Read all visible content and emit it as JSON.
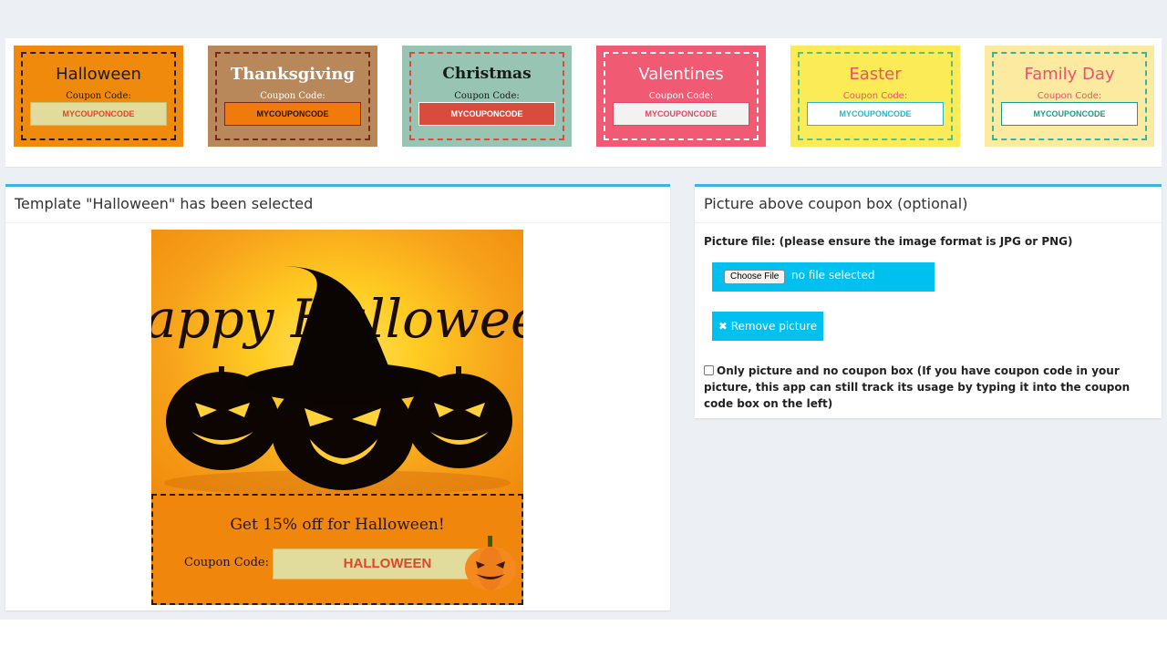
{
  "templates": [
    {
      "title": "Halloween",
      "coupon_label": "Coupon Code:",
      "code": "MYCOUPONCODE",
      "bg": "#f08a0c",
      "border": "#2b1b0b",
      "title_color": "#1a1a1a",
      "label_color": "#1a1a1a",
      "code_bg": "#e2dc9c",
      "code_border": "#c9c070",
      "code_color": "#e0472a"
    },
    {
      "title": "Thanksgiving",
      "coupon_label": "Coupon Code:",
      "code": "MYCOUPONCODE",
      "bg": "#b8875a",
      "border": "#7a2a1a",
      "title_color": "#ffffff",
      "label_color": "#ffffff",
      "code_bg": "#f07a0c",
      "code_border": "#7a2a1a",
      "code_color": "#2b1406"
    },
    {
      "title": "Christmas",
      "coupon_label": "Coupon Code:",
      "code": "MYCOUPONCODE",
      "bg": "#97c4b3",
      "border": "#d84c3e",
      "title_color": "#1a1a1a",
      "label_color": "#1a1a1a",
      "code_bg": "#d84c3e",
      "code_border": "#ffffff",
      "code_color": "#ffffff"
    },
    {
      "title": "Valentines",
      "coupon_label": "Coupon Code:",
      "code": "MYCOUPONCODE",
      "bg": "#f05a72",
      "border": "#ffffff",
      "title_color": "#ffffff",
      "label_color": "#ffffff",
      "code_bg": "#f2f2f2",
      "code_border": "#e04862",
      "code_color": "#e04862"
    },
    {
      "title": "Easter",
      "coupon_label": "Coupon Code:",
      "code": "MYCOUPONCODE",
      "bg": "#fbec57",
      "border": "#5bbf78",
      "title_color": "#f0506e",
      "label_color": "#f0506e",
      "code_bg": "#ffffff",
      "code_border": "#2bb5c7",
      "code_color": "#2bb5c7"
    },
    {
      "title": "Family Day",
      "coupon_label": "Coupon Code:",
      "code": "MYCOUPONCODE",
      "bg": "#fbeaa0",
      "border": "#3bb59a",
      "title_color": "#f0506e",
      "label_color": "#f0506e",
      "code_bg": "#ffffff",
      "code_border": "#1c9d82",
      "code_color": "#1c9d82"
    }
  ],
  "preview": {
    "title": "Template \"Halloween\" has been selected",
    "image_text": "Happy Halloween",
    "headline": "Get 15% off for Halloween!",
    "coupon_label": "Coupon Code:",
    "coupon_code": "HALLOWEEN"
  },
  "picture": {
    "title": "Picture above coupon box (optional)",
    "file_label": "Picture file: (please ensure the image format is JPG or PNG)",
    "choose_file": "Choose File",
    "no_file": "no file selected",
    "remove_button": "✖ Remove picture",
    "only_picture_text": "Only picture and no coupon box (If you have coupon code in your picture, this app can still track its usage by typing it into the coupon code box on the left)",
    "only_picture_checked": false
  },
  "colors": {
    "accent": "#3ab5e6",
    "button": "#00c0ef"
  }
}
